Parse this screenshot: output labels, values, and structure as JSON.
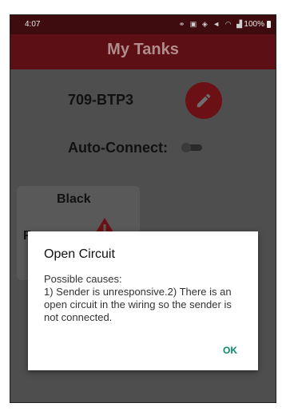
{
  "status_bar": {
    "time": "4:07",
    "battery": "100%"
  },
  "app_bar": {
    "title": "My Tanks"
  },
  "tank": {
    "name": "709-BTP3",
    "auto_connect_label": "Auto-Connect:",
    "auto_connect_on": false
  },
  "card": {
    "label": "Black",
    "partial_text": "F"
  },
  "dialog": {
    "title": "Open Circuit",
    "body": "Possible causes:\n1) Sender is unresponsive.2) There is an open circuit in the wiring so the sender is not connected.",
    "ok_label": "OK"
  },
  "colors": {
    "app_bar": "#5c0f14",
    "accent": "#0a8a6a"
  },
  "icons": [
    "pencil-icon",
    "warning-icon",
    "battery-icon",
    "signal-icon",
    "wifi-icon"
  ]
}
